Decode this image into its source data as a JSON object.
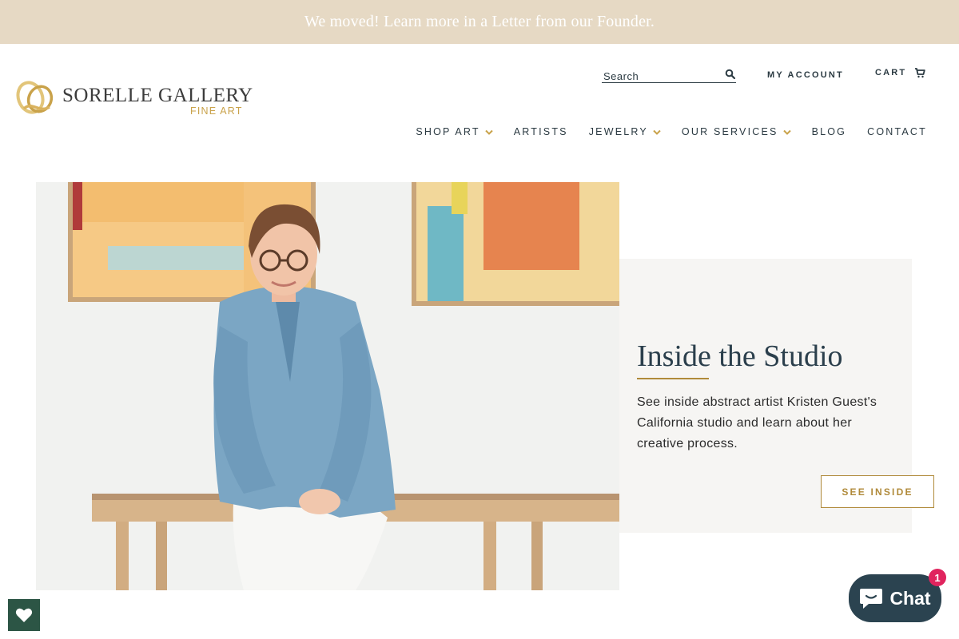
{
  "announcement": {
    "text": "We moved! Learn more in a Letter from our Founder."
  },
  "logo": {
    "name": "SORELLE GALLERY",
    "subtitle": "FINE ART"
  },
  "header": {
    "search_placeholder": "Search",
    "account_label": "MY ACCOUNT",
    "cart_label": "CART"
  },
  "nav": {
    "items": [
      {
        "label": "SHOP ART",
        "has_dropdown": true
      },
      {
        "label": "ARTISTS",
        "has_dropdown": false
      },
      {
        "label": "JEWELRY",
        "has_dropdown": true
      },
      {
        "label": "OUR SERVICES",
        "has_dropdown": true
      },
      {
        "label": "BLOG",
        "has_dropdown": false
      },
      {
        "label": "CONTACT",
        "has_dropdown": false
      }
    ]
  },
  "feature": {
    "title": "Inside the Studio",
    "body": "See inside abstract artist Kristen Guest's California studio and learn about her creative process.",
    "button_label": "SEE INSIDE"
  },
  "chat": {
    "label": "Chat",
    "badge_count": "1"
  },
  "colors": {
    "accent_gold": "#b08a3a",
    "announce_bg": "#e6d9c4",
    "navy": "#2b3a42",
    "chat_bg": "#2b4350",
    "wishlist_green": "#2c5545"
  }
}
